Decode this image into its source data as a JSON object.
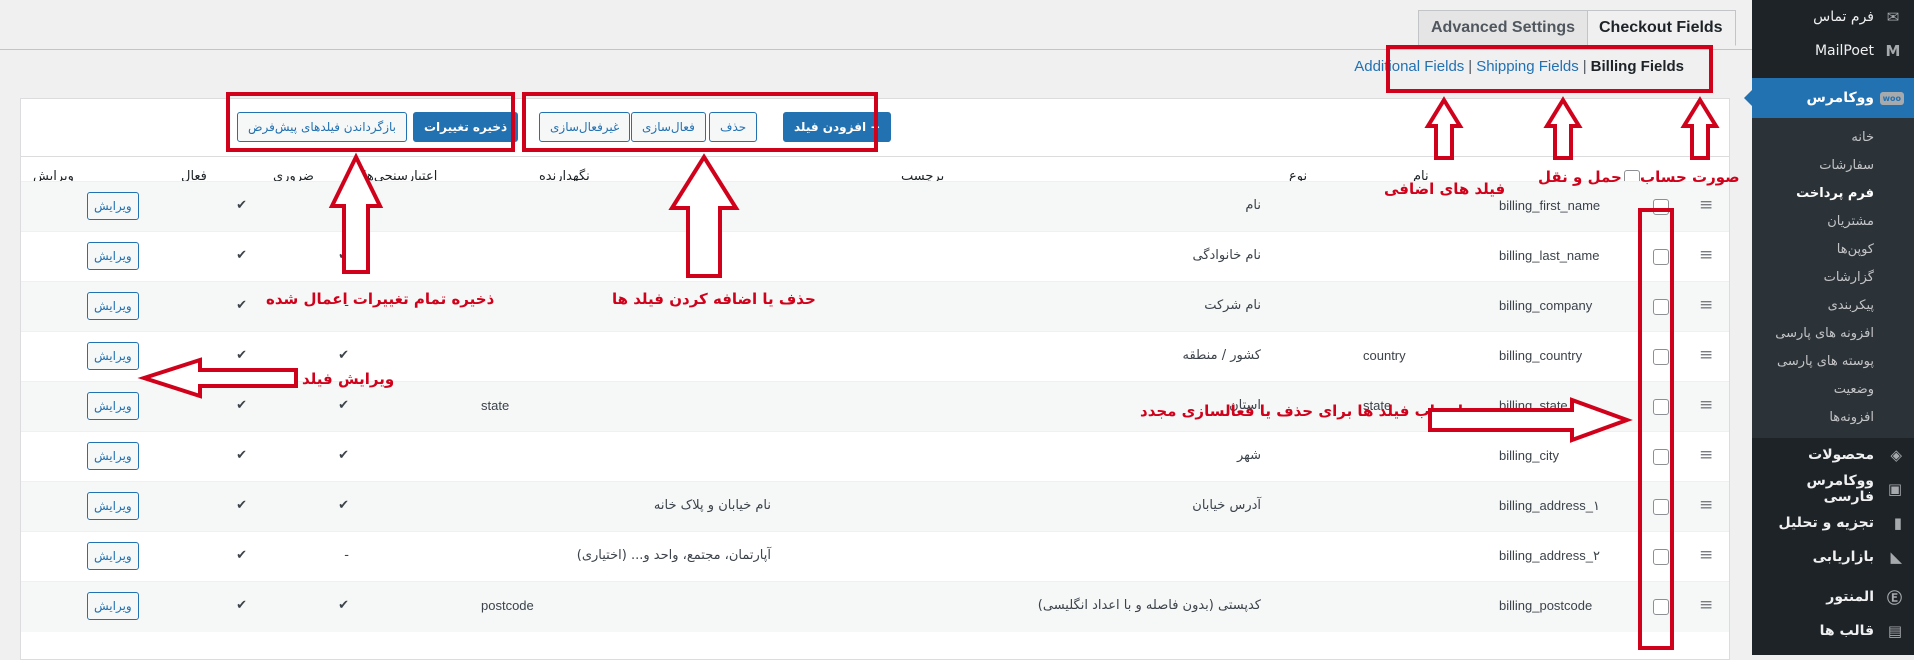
{
  "sidebar": {
    "top_items": [
      {
        "label": "فرم تماس",
        "icon": "envelope-icon"
      },
      {
        "label": "MailPoet",
        "icon": "mailpoet-icon"
      }
    ],
    "active": {
      "label": "ووکامرس",
      "icon": "woo-icon",
      "icon_text": "woo"
    },
    "submenu": [
      "خانه",
      "سفارشات",
      "فرم پرداخت",
      "مشتریان",
      "کوپن‌ها",
      "گزارشات",
      "پیکربندی",
      "افزونه های پارسی",
      "پوسته های پارسی",
      "وضعیت",
      "افزونه‌ها"
    ],
    "current_submenu": "فرم پرداخت",
    "items": [
      {
        "label": "محصولات",
        "icon": "box-icon"
      },
      {
        "label": "ووکامرس فارسی",
        "icon": "cart-icon"
      },
      {
        "label": "تجزیه و تحلیل",
        "icon": "bar-chart-icon"
      },
      {
        "label": "بازاریابی",
        "icon": "megaphone-icon"
      },
      {
        "label": "المنتور",
        "icon": "elementor-icon"
      },
      {
        "label": "قالب ها",
        "icon": "folder-icon"
      }
    ]
  },
  "tabs": {
    "checkout": "Checkout Fields",
    "advanced": "Advanced Settings"
  },
  "subnav": {
    "billing": "Billing Fields",
    "shipping": "Shipping Fields",
    "additional": "Additional Fields",
    "sep": "|"
  },
  "toolbar": {
    "add_field": "+ افزودن فیلد",
    "remove": "حذف",
    "enable": "فعال‌سازی",
    "disable": "غیرفعال‌سازی",
    "save": "ذخیره تغییرات",
    "reset": "بازگرداندن فیلدهای پیش‌فرض"
  },
  "columns": {
    "name": "نام",
    "type": "نوع",
    "label": "برچسب",
    "placeholder": "نگهدارنده",
    "validation": "اعتبارسنجی‌ها",
    "required": "ضروری",
    "enabled": "فعال",
    "edit": "ویرایش"
  },
  "rows": [
    {
      "name": "billing_first_name",
      "type": "",
      "label": "نام",
      "placeholder": "",
      "validation": "",
      "required": "✔",
      "enabled": "✔",
      "edit": "ویرایش"
    },
    {
      "name": "billing_last_name",
      "type": "",
      "label": "نام خانوادگی",
      "placeholder": "",
      "validation": "",
      "required": "✔",
      "enabled": "✔",
      "edit": "ویرایش"
    },
    {
      "name": "billing_company",
      "type": "",
      "label": "نام شرکت",
      "placeholder": "",
      "validation": "",
      "required": "-",
      "enabled": "✔",
      "edit": "ویرایش"
    },
    {
      "name": "billing_country",
      "type": "country",
      "label": "کشور / منطقه",
      "placeholder": "",
      "validation": "",
      "required": "✔",
      "enabled": "✔",
      "edit": "ویرایش"
    },
    {
      "name": "billing_state",
      "type": "state",
      "label": "استان",
      "placeholder": "",
      "validation": "state",
      "required": "✔",
      "enabled": "✔",
      "edit": "ویرایش"
    },
    {
      "name": "billing_city",
      "type": "",
      "label": "شهر",
      "placeholder": "",
      "validation": "",
      "required": "✔",
      "enabled": "✔",
      "edit": "ویرایش"
    },
    {
      "name": "billing_address_۱",
      "type": "",
      "label": "آدرس خیابان",
      "placeholder": "نام خیابان و پلاک خانه",
      "validation": "",
      "required": "✔",
      "enabled": "✔",
      "edit": "ویرایش"
    },
    {
      "name": "billing_address_۲",
      "type": "",
      "label": "",
      "placeholder": "آپارتمان، مجتمع، واحد و... (اختیاری)",
      "validation": "",
      "required": "-",
      "enabled": "✔",
      "edit": "ویرایش"
    },
    {
      "name": "billing_postcode",
      "type": "",
      "label": "کدپستی (بدون فاصله و با اعداد انگلیسی)",
      "placeholder": "",
      "validation": "postcode",
      "required": "✔",
      "enabled": "✔",
      "edit": "ویرایش"
    }
  ],
  "annotations": {
    "billing": "صورت حساب",
    "shipping": "حمل و نقل",
    "additional": "فیلد های اضافی",
    "toolbar_actions": "حذف یا اضافه کردن فیلد ها",
    "save_all": "ذخیره تمام تغییرات اعمال شده",
    "edit_field": "ویرایش فیلد",
    "select_fields": "انتخاب فیلد ها برای حذف یا فعالسازی مجدد"
  },
  "colors": {
    "accent": "#2271b1",
    "annotation": "#d0021b",
    "sidebar_bg": "#1d2327"
  }
}
